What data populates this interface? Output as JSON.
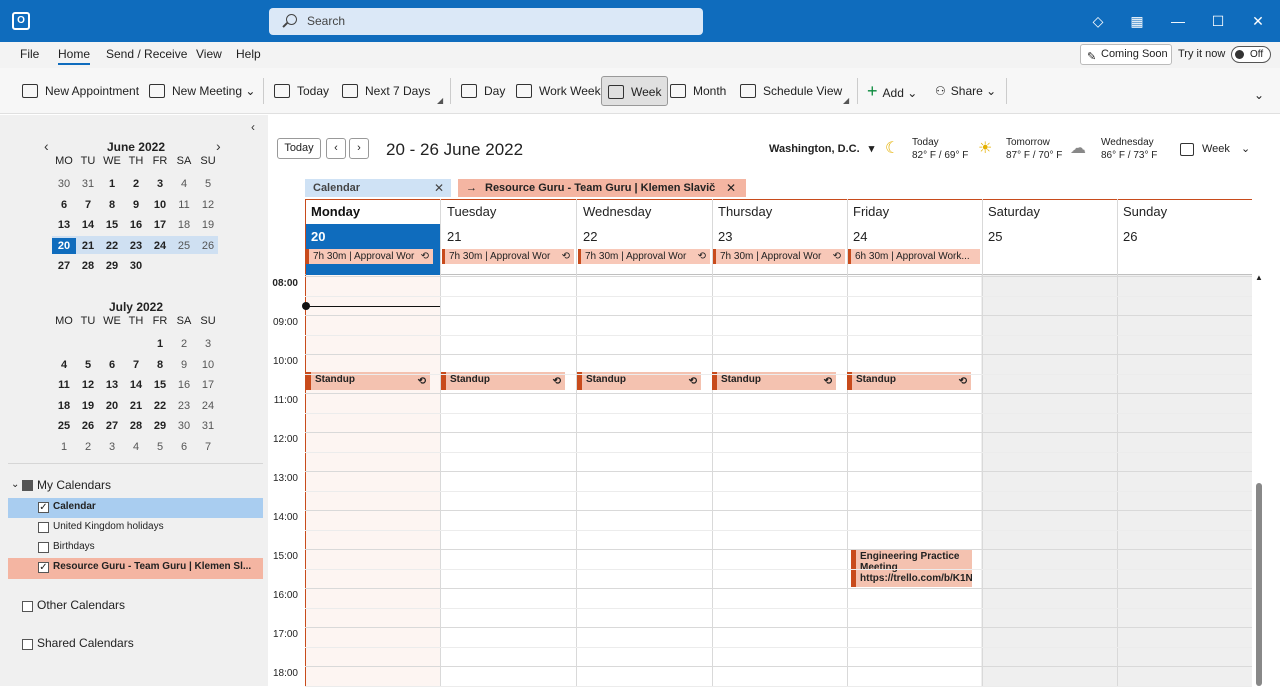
{
  "search": {
    "placeholder": "Search"
  },
  "menu": [
    "File",
    "Home",
    "Send / Receive",
    "View",
    "Help"
  ],
  "coming_soon": {
    "label": "Coming Soon",
    "try_label": "Try it now",
    "toggle_label": "Off"
  },
  "ribbon": {
    "new_appointment": "New Appointment",
    "new_meeting": "New Meeting",
    "today": "Today",
    "next7": "Next 7 Days",
    "day": "Day",
    "work_week": "Work Week",
    "week": "Week",
    "month": "Month",
    "schedule": "Schedule View",
    "add": "Add",
    "share": "Share"
  },
  "mini_cal": {
    "dows": [
      "MO",
      "TU",
      "WE",
      "TH",
      "FR",
      "SA",
      "SU"
    ],
    "june": {
      "title": "June 2022",
      "weeks": [
        [
          "30",
          "31",
          "1",
          "2",
          "3",
          "4",
          "5"
        ],
        [
          "6",
          "7",
          "8",
          "9",
          "10",
          "11",
          "12"
        ],
        [
          "13",
          "14",
          "15",
          "16",
          "17",
          "18",
          "19"
        ],
        [
          "20",
          "21",
          "22",
          "23",
          "24",
          "25",
          "26"
        ],
        [
          "27",
          "28",
          "29",
          "30",
          "",
          "",
          ""
        ]
      ]
    },
    "july": {
      "title": "July 2022",
      "weeks": [
        [
          "",
          "",
          "",
          "",
          "1",
          "2",
          "3"
        ],
        [
          "4",
          "5",
          "6",
          "7",
          "8",
          "9",
          "10"
        ],
        [
          "11",
          "12",
          "13",
          "14",
          "15",
          "16",
          "17"
        ],
        [
          "18",
          "19",
          "20",
          "21",
          "22",
          "23",
          "24"
        ],
        [
          "25",
          "26",
          "27",
          "28",
          "29",
          "30",
          "31"
        ],
        [
          "1",
          "2",
          "3",
          "4",
          "5",
          "6",
          "7"
        ]
      ]
    }
  },
  "tree": {
    "my_calendars": "My Calendars",
    "calendar": "Calendar",
    "uk_holidays": "United Kingdom holidays",
    "birthdays": "Birthdays",
    "resource_guru": "Resource Guru - Team Guru | Klemen Sl...",
    "other": "Other Calendars",
    "shared": "Shared Calendars"
  },
  "header": {
    "today_btn": "Today",
    "range": "20 - 26 June 2022",
    "location": "Washington, D.C.",
    "weather": [
      {
        "day": "Today",
        "temp": "82° F / 69° F"
      },
      {
        "day": "Tomorrow",
        "temp": "87° F / 70° F"
      },
      {
        "day": "Wednesday",
        "temp": "86° F / 73° F"
      }
    ],
    "view": "Week"
  },
  "tabs": {
    "calendar": "Calendar",
    "resource": "Resource Guru - Team Guru | Klemen Slavič"
  },
  "days": [
    {
      "name": "Monday",
      "num": "20",
      "allday": "7h 30m | Approval Wor"
    },
    {
      "name": "Tuesday",
      "num": "21",
      "allday": "7h 30m | Approval Wor"
    },
    {
      "name": "Wednesday",
      "num": "22",
      "allday": "7h 30m | Approval Wor"
    },
    {
      "name": "Thursday",
      "num": "23",
      "allday": "7h 30m | Approval Wor"
    },
    {
      "name": "Friday",
      "num": "24",
      "allday": "6h 30m | Approval Work..."
    },
    {
      "name": "Saturday",
      "num": "25",
      "allday": ""
    },
    {
      "name": "Sunday",
      "num": "26",
      "allday": ""
    }
  ],
  "hours": [
    "08:00",
    "09:00",
    "10:00",
    "11:00",
    "12:00",
    "13:00",
    "14:00",
    "15:00",
    "16:00",
    "17:00",
    "18:00"
  ],
  "events": {
    "standup": "Standup",
    "engineering": "Engineering Practice Meeting https://trello.com/b/K1N"
  }
}
